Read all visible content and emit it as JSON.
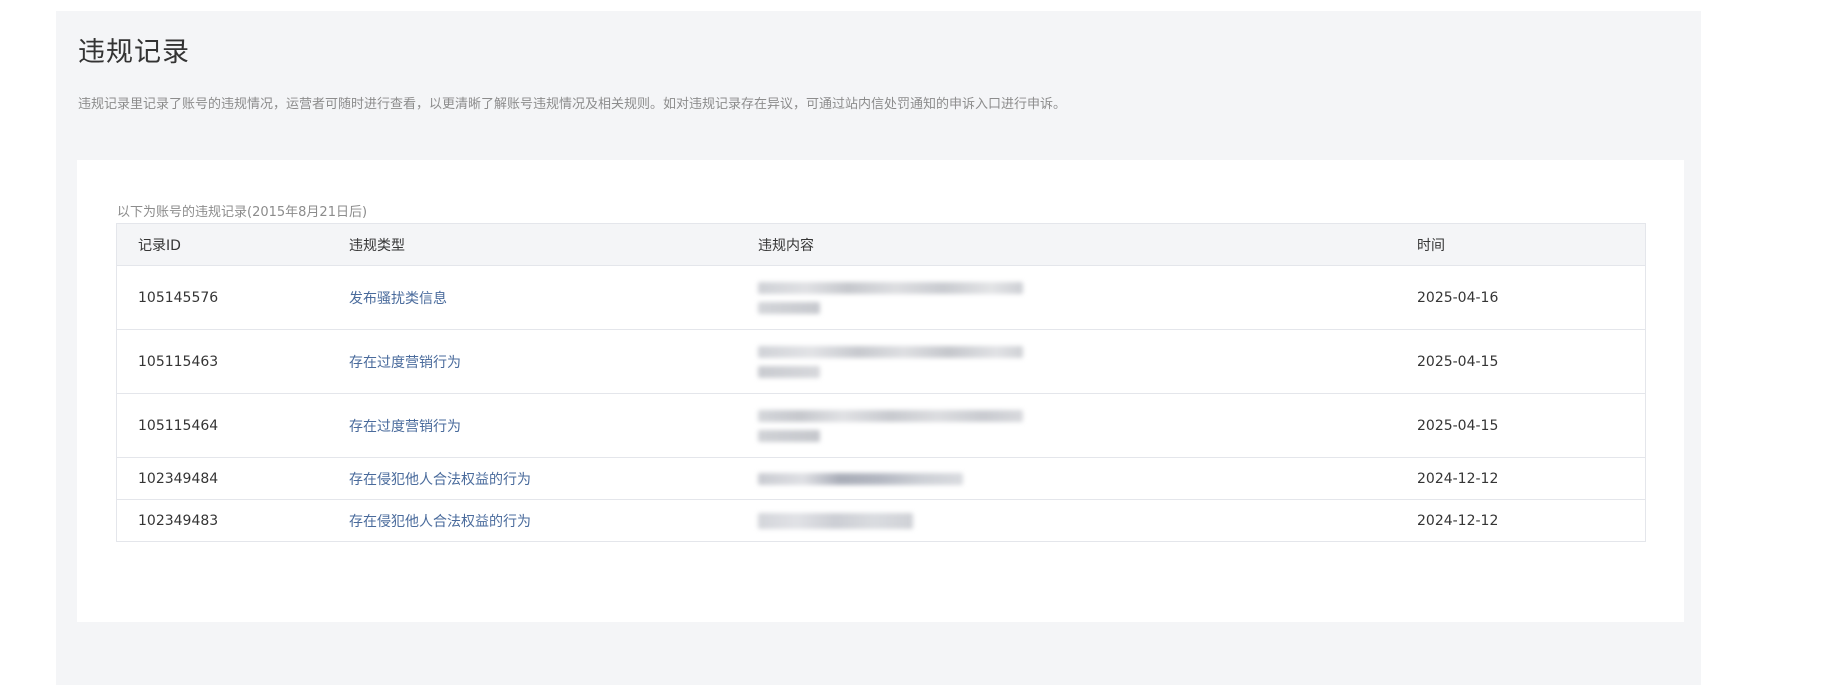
{
  "page": {
    "title": "违规记录",
    "description": "违规记录里记录了账号的违规情况，运营者可随时进行查看，以更清晰了解账号违规情况及相关规则。如对违规记录存在异议，可通过站内信处罚通知的申诉入口进行申诉。"
  },
  "table": {
    "caption": "以下为账号的违规记录(2015年8月21日后)",
    "headers": {
      "id": "记录ID",
      "type": "违规类型",
      "content": "违规内容",
      "time": "时间"
    },
    "rows": [
      {
        "id": "105145576",
        "type": "发布骚扰类信息",
        "time": "2025-04-16"
      },
      {
        "id": "105115463",
        "type": "存在过度营销行为",
        "time": "2025-04-15"
      },
      {
        "id": "105115464",
        "type": "存在过度营销行为",
        "time": "2025-04-15"
      },
      {
        "id": "102349484",
        "type": "存在侵犯他人合法权益的行为",
        "time": "2024-12-12"
      },
      {
        "id": "102349483",
        "type": "存在侵犯他人合法权益的行为",
        "time": "2024-12-12"
      }
    ]
  },
  "colors": {
    "panel_bg": "#f4f5f7",
    "link": "#4a6b9c",
    "muted_text": "#8c8c8c"
  }
}
